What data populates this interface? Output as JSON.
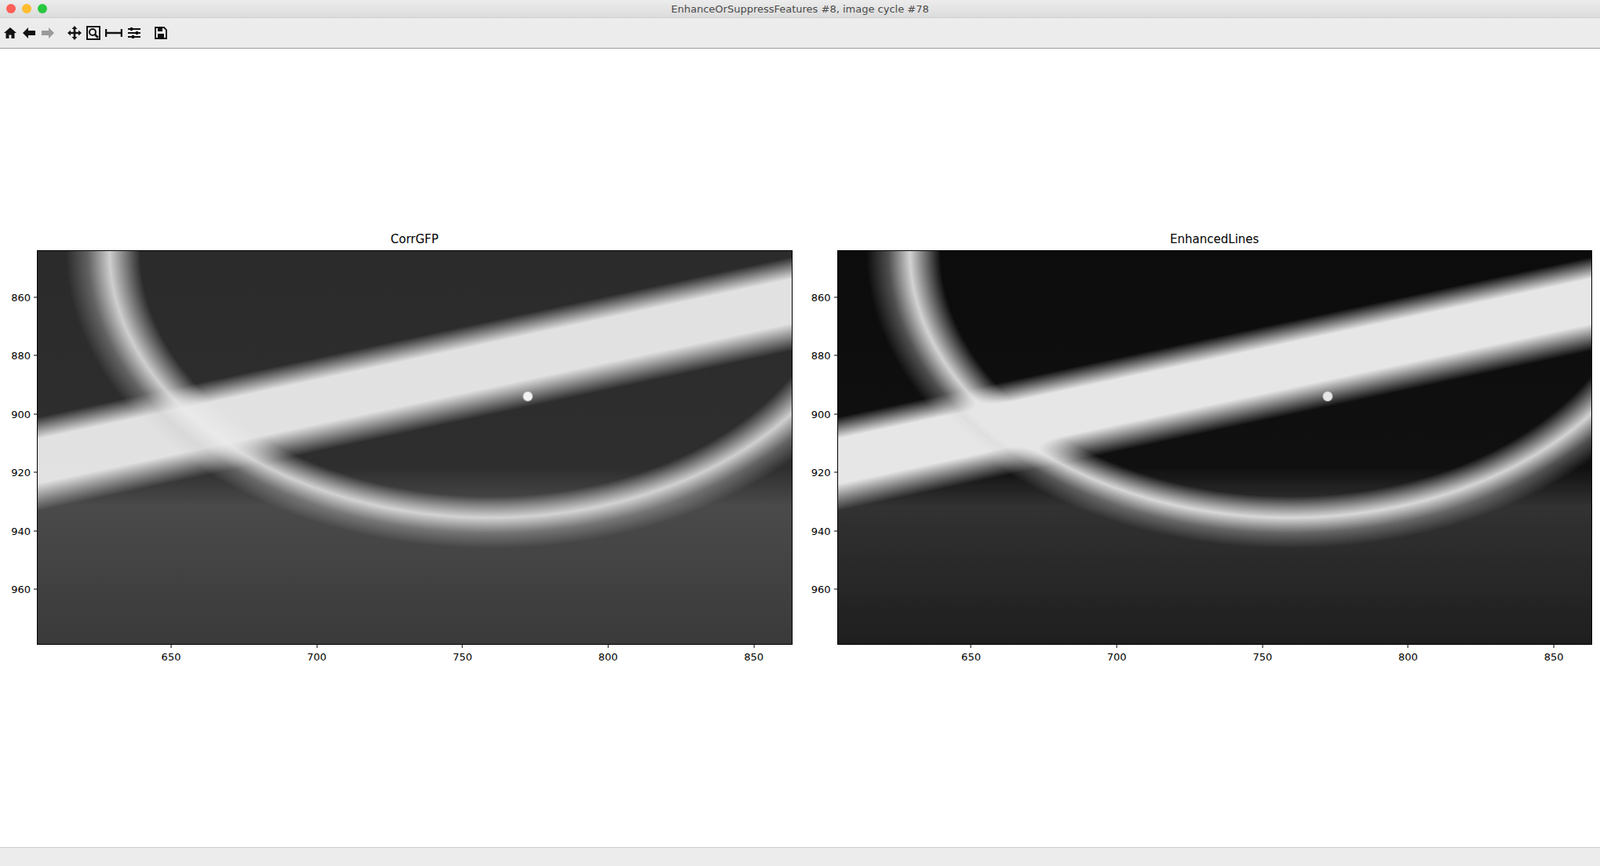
{
  "window": {
    "title": "EnhanceOrSuppressFeatures #8, image cycle #78"
  },
  "toolbar": [
    {
      "kind": "home",
      "disabled": false
    },
    {
      "kind": "back",
      "disabled": false
    },
    {
      "kind": "forward",
      "disabled": true
    },
    {
      "kind": "pan",
      "disabled": false
    },
    {
      "kind": "zoom",
      "disabled": false
    },
    {
      "kind": "subplots",
      "disabled": false
    },
    {
      "kind": "options",
      "disabled": false
    },
    {
      "kind": "save",
      "disabled": false
    }
  ],
  "axes": [
    {
      "title": "CorrGFP",
      "x_range": [
        604.2,
        862.9
      ],
      "y_range": [
        844.3,
        978.7
      ],
      "x_ticks": [
        "650",
        "700",
        "750",
        "800",
        "850"
      ],
      "y_ticks": [
        "860",
        "880",
        "900",
        "920",
        "940",
        "960"
      ]
    },
    {
      "title": "EnhancedLines",
      "x_range": [
        604.2,
        862.9
      ],
      "y_range": [
        844.3,
        978.7
      ],
      "x_ticks": [
        "650",
        "700",
        "750",
        "800",
        "850"
      ],
      "y_ticks": [
        "860",
        "880",
        "900",
        "920",
        "940",
        "960"
      ]
    }
  ]
}
